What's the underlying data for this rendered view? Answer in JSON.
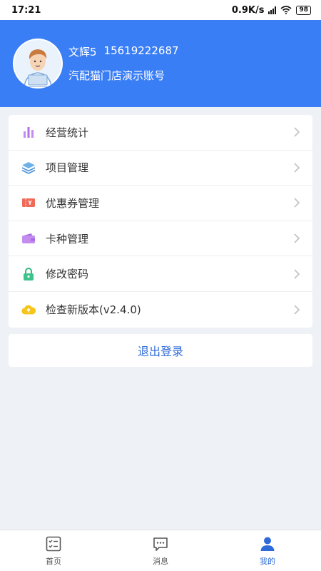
{
  "status_bar": {
    "time": "17:21",
    "speed": "0.9K/s",
    "battery": "98"
  },
  "profile": {
    "name": "文辉5",
    "phone": "15619222687",
    "store": "汽配猫门店演示账号"
  },
  "menu": [
    {
      "label": "经营统计",
      "icon": "bar-chart-icon"
    },
    {
      "label": "项目管理",
      "icon": "layers-icon"
    },
    {
      "label": "优惠券管理",
      "icon": "coupon-icon"
    },
    {
      "label": "卡种管理",
      "icon": "wallet-icon"
    },
    {
      "label": "修改密码",
      "icon": "lock-icon"
    },
    {
      "label": "检查新版本(v2.4.0)",
      "icon": "cloud-upload-icon"
    }
  ],
  "logout_label": "退出登录",
  "nav": [
    {
      "label": "首页",
      "icon": "home-checklist-icon"
    },
    {
      "label": "消息",
      "icon": "message-icon"
    },
    {
      "label": "我的",
      "icon": "user-icon",
      "active": true
    }
  ],
  "colors": {
    "accent": "#3a7ef6",
    "link": "#2f6bd8"
  }
}
